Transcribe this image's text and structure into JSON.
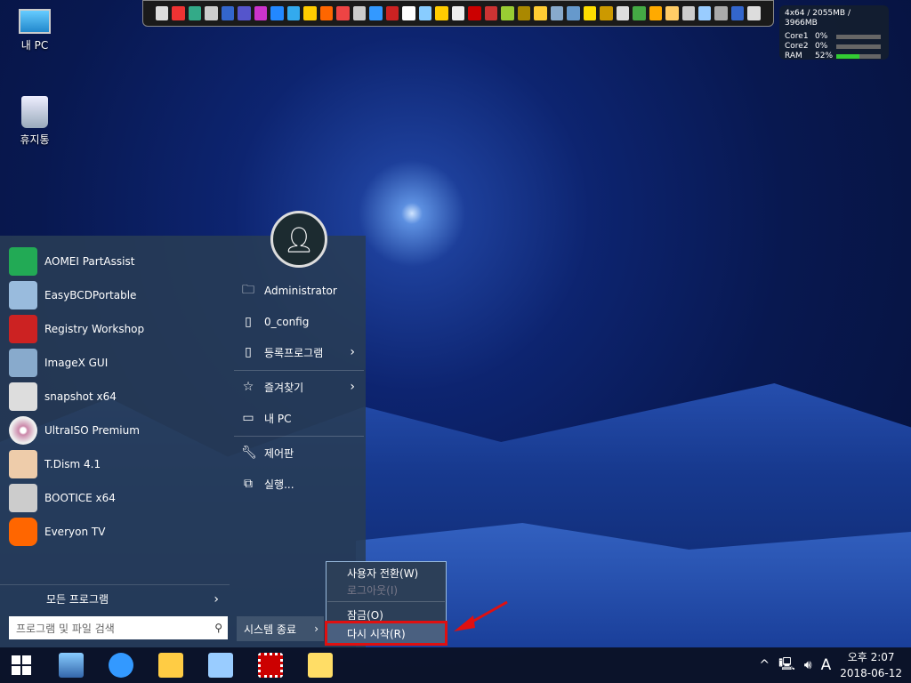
{
  "desktop": {
    "icons": [
      {
        "label": "내 PC"
      },
      {
        "label": "휴지통"
      }
    ]
  },
  "meter": {
    "header": "4x64 / 2055MB / 3966MB",
    "rows": [
      {
        "label": "Core1",
        "value": "0%",
        "fill": 0
      },
      {
        "label": "Core2",
        "value": "0%",
        "fill": 0
      },
      {
        "label": "RAM",
        "value": "52%",
        "fill": 52
      }
    ]
  },
  "start": {
    "apps": [
      {
        "label": "AOMEI PartAssist"
      },
      {
        "label": "EasyBCDPortable"
      },
      {
        "label": "Registry Workshop"
      },
      {
        "label": "ImageX GUI"
      },
      {
        "label": "snapshot x64"
      },
      {
        "label": "UltraISO Premium"
      },
      {
        "label": "T.Dism 4.1"
      },
      {
        "label": "BOOTICE x64"
      },
      {
        "label": "Everyon TV"
      }
    ],
    "all_programs": "모든 프로그램",
    "search_placeholder": "프로그램 및 파일 검색",
    "right": [
      {
        "label": "Administrator"
      },
      {
        "label": "0_config"
      },
      {
        "label": "등록프로그램"
      },
      {
        "label": "즐겨찾기"
      },
      {
        "label": "내 PC"
      },
      {
        "label": "제어판"
      },
      {
        "label": "실행..."
      }
    ],
    "shutdown": "시스템 종료"
  },
  "context_menu": [
    {
      "label": "사용자 전환(W)"
    },
    {
      "label": "로그아웃(I)",
      "disabled": true
    },
    {
      "label": "잠금(O)"
    },
    {
      "label": "다시 시작(R)",
      "highlighted": true
    }
  ],
  "tray": {
    "ime": "A",
    "time": "오후 2:07",
    "date": "2018-06-12"
  },
  "colors": {
    "highlight_border": "#e01010",
    "accent_arrow": "#e01010"
  }
}
